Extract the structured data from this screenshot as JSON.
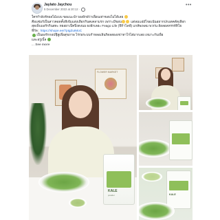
{
  "post": {
    "author": "Jaylato Jaychou",
    "timestamp": "5 December 2022 at 20:12 ·",
    "more_icon": "more-dots-icon",
    "audience_icon": "globe-icon",
    "caption": {
      "line1": "ใครกำลังหักผลไม้แบบ ขอแนะนำวองยักษ์ว่าเพื่อนเท่าขอบไม่ได้เลย",
      "line2": "คือแซ่มร์เป็นสาวคอดคั้งสีเข้มแต่งเลือกกินคเคลามรก เพราะมีขอบ",
      "line2b": "แต่ลมแอ่มัไขอเน้นอยากปกแตคตัดเลือก",
      "line3": "สุดเพ็บแอรักกินสดะ หยอยาเป็คปิ่งตงนม ผงยักเลอะ Feago Life (ฟีก้าไลฟ์) แกสัพเพลม พวก่น ล้อลอลหรรห์ทิโย",
      "line4_prefix": "ที่กัล :",
      "link": "https://shope.ee/7pIgZuIMoC",
      "line5": "เป็นผงรักกอปฟุ๊สูเพื่อสุขภาพ ไร่ก่อระบบกำหลอเลินกิดลสองงข่าทาไรไส่มากเลย เหมาะกับเพื่อ",
      "line6": "และอรูเบิ้ล",
      "see_more": "See more"
    },
    "photos": {
      "main": {
        "poster_text": "FLOWER MARKET",
        "pack_label": "KALE",
        "pack_sub": "powder"
      },
      "thumb_c": {
        "pack_label": "KALE"
      }
    }
  }
}
